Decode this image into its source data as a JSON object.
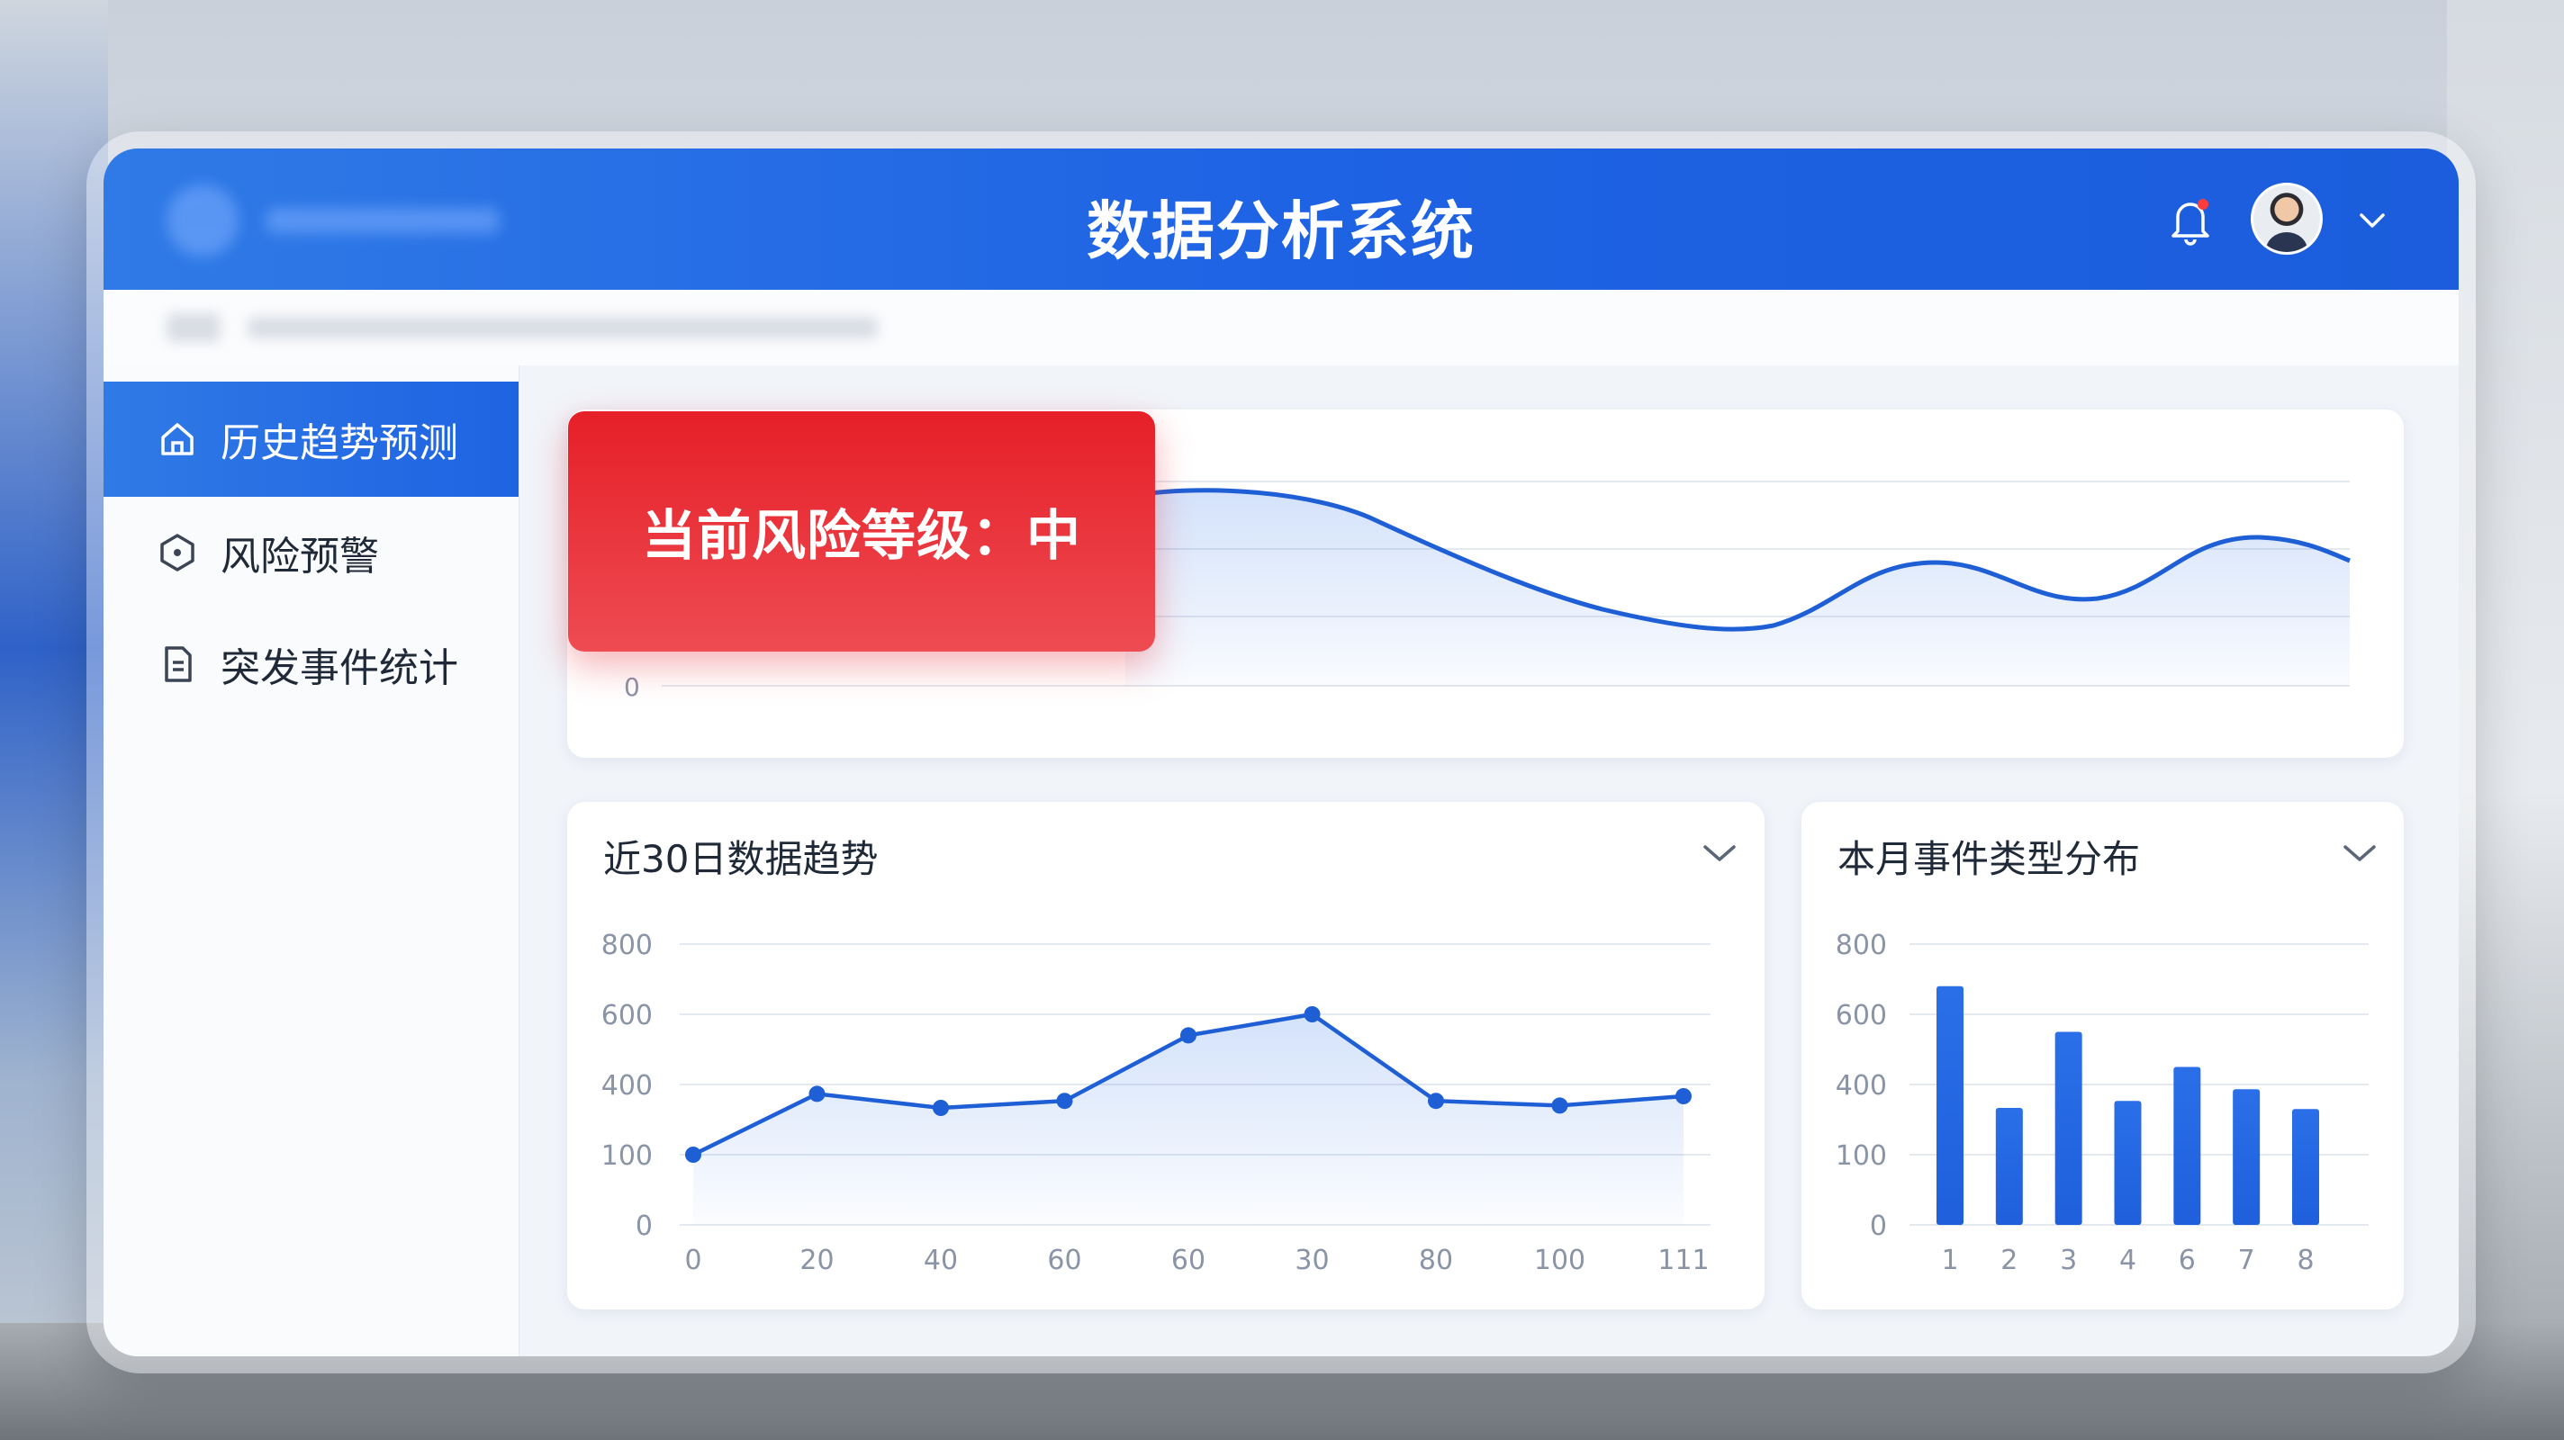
{
  "app": {
    "title": "数据分析系统"
  },
  "header": {
    "notification_icon": "bell-icon",
    "user_menu_icon": "chevron-down-icon"
  },
  "sidebar": {
    "items": [
      {
        "label": "历史趋势预测",
        "icon": "home-icon",
        "active": true
      },
      {
        "label": "风险预警",
        "icon": "hexagon-icon",
        "active": false
      },
      {
        "label": "突发事件统计",
        "icon": "document-icon",
        "active": false
      }
    ]
  },
  "risk_banner": {
    "label": "当前风险等级：中"
  },
  "trend_panel": {
    "y_tick": "0"
  },
  "line_panel": {
    "title": "近30日数据趋势"
  },
  "bar_panel": {
    "title": "本月事件类型分布"
  },
  "colors": {
    "primary": "#1f63e2",
    "risk": "#e61f28",
    "line": "#1e5fd6"
  },
  "chart_data": [
    {
      "type": "line",
      "title": "",
      "xlabel": "",
      "ylabel": "",
      "x_tick_labels": [
        "0",
        "20",
        "40",
        "60",
        "60",
        "30",
        "80",
        "100",
        "111"
      ],
      "y_tick_labels": [
        "0",
        "100",
        "400",
        "600",
        "800"
      ],
      "values": [
        100,
        360,
        300,
        330,
        540,
        600,
        330,
        310,
        350
      ],
      "markers": true,
      "area_fill": true,
      "grid": true
    },
    {
      "type": "bar",
      "title": "",
      "xlabel": "",
      "ylabel": "",
      "categories": [
        "1",
        "2",
        "3",
        "4",
        "6",
        "7",
        "8"
      ],
      "y_tick_labels": [
        "0",
        "100",
        "400",
        "600",
        "800"
      ],
      "values": [
        680,
        300,
        550,
        330,
        450,
        380,
        295
      ],
      "grid": true
    }
  ]
}
